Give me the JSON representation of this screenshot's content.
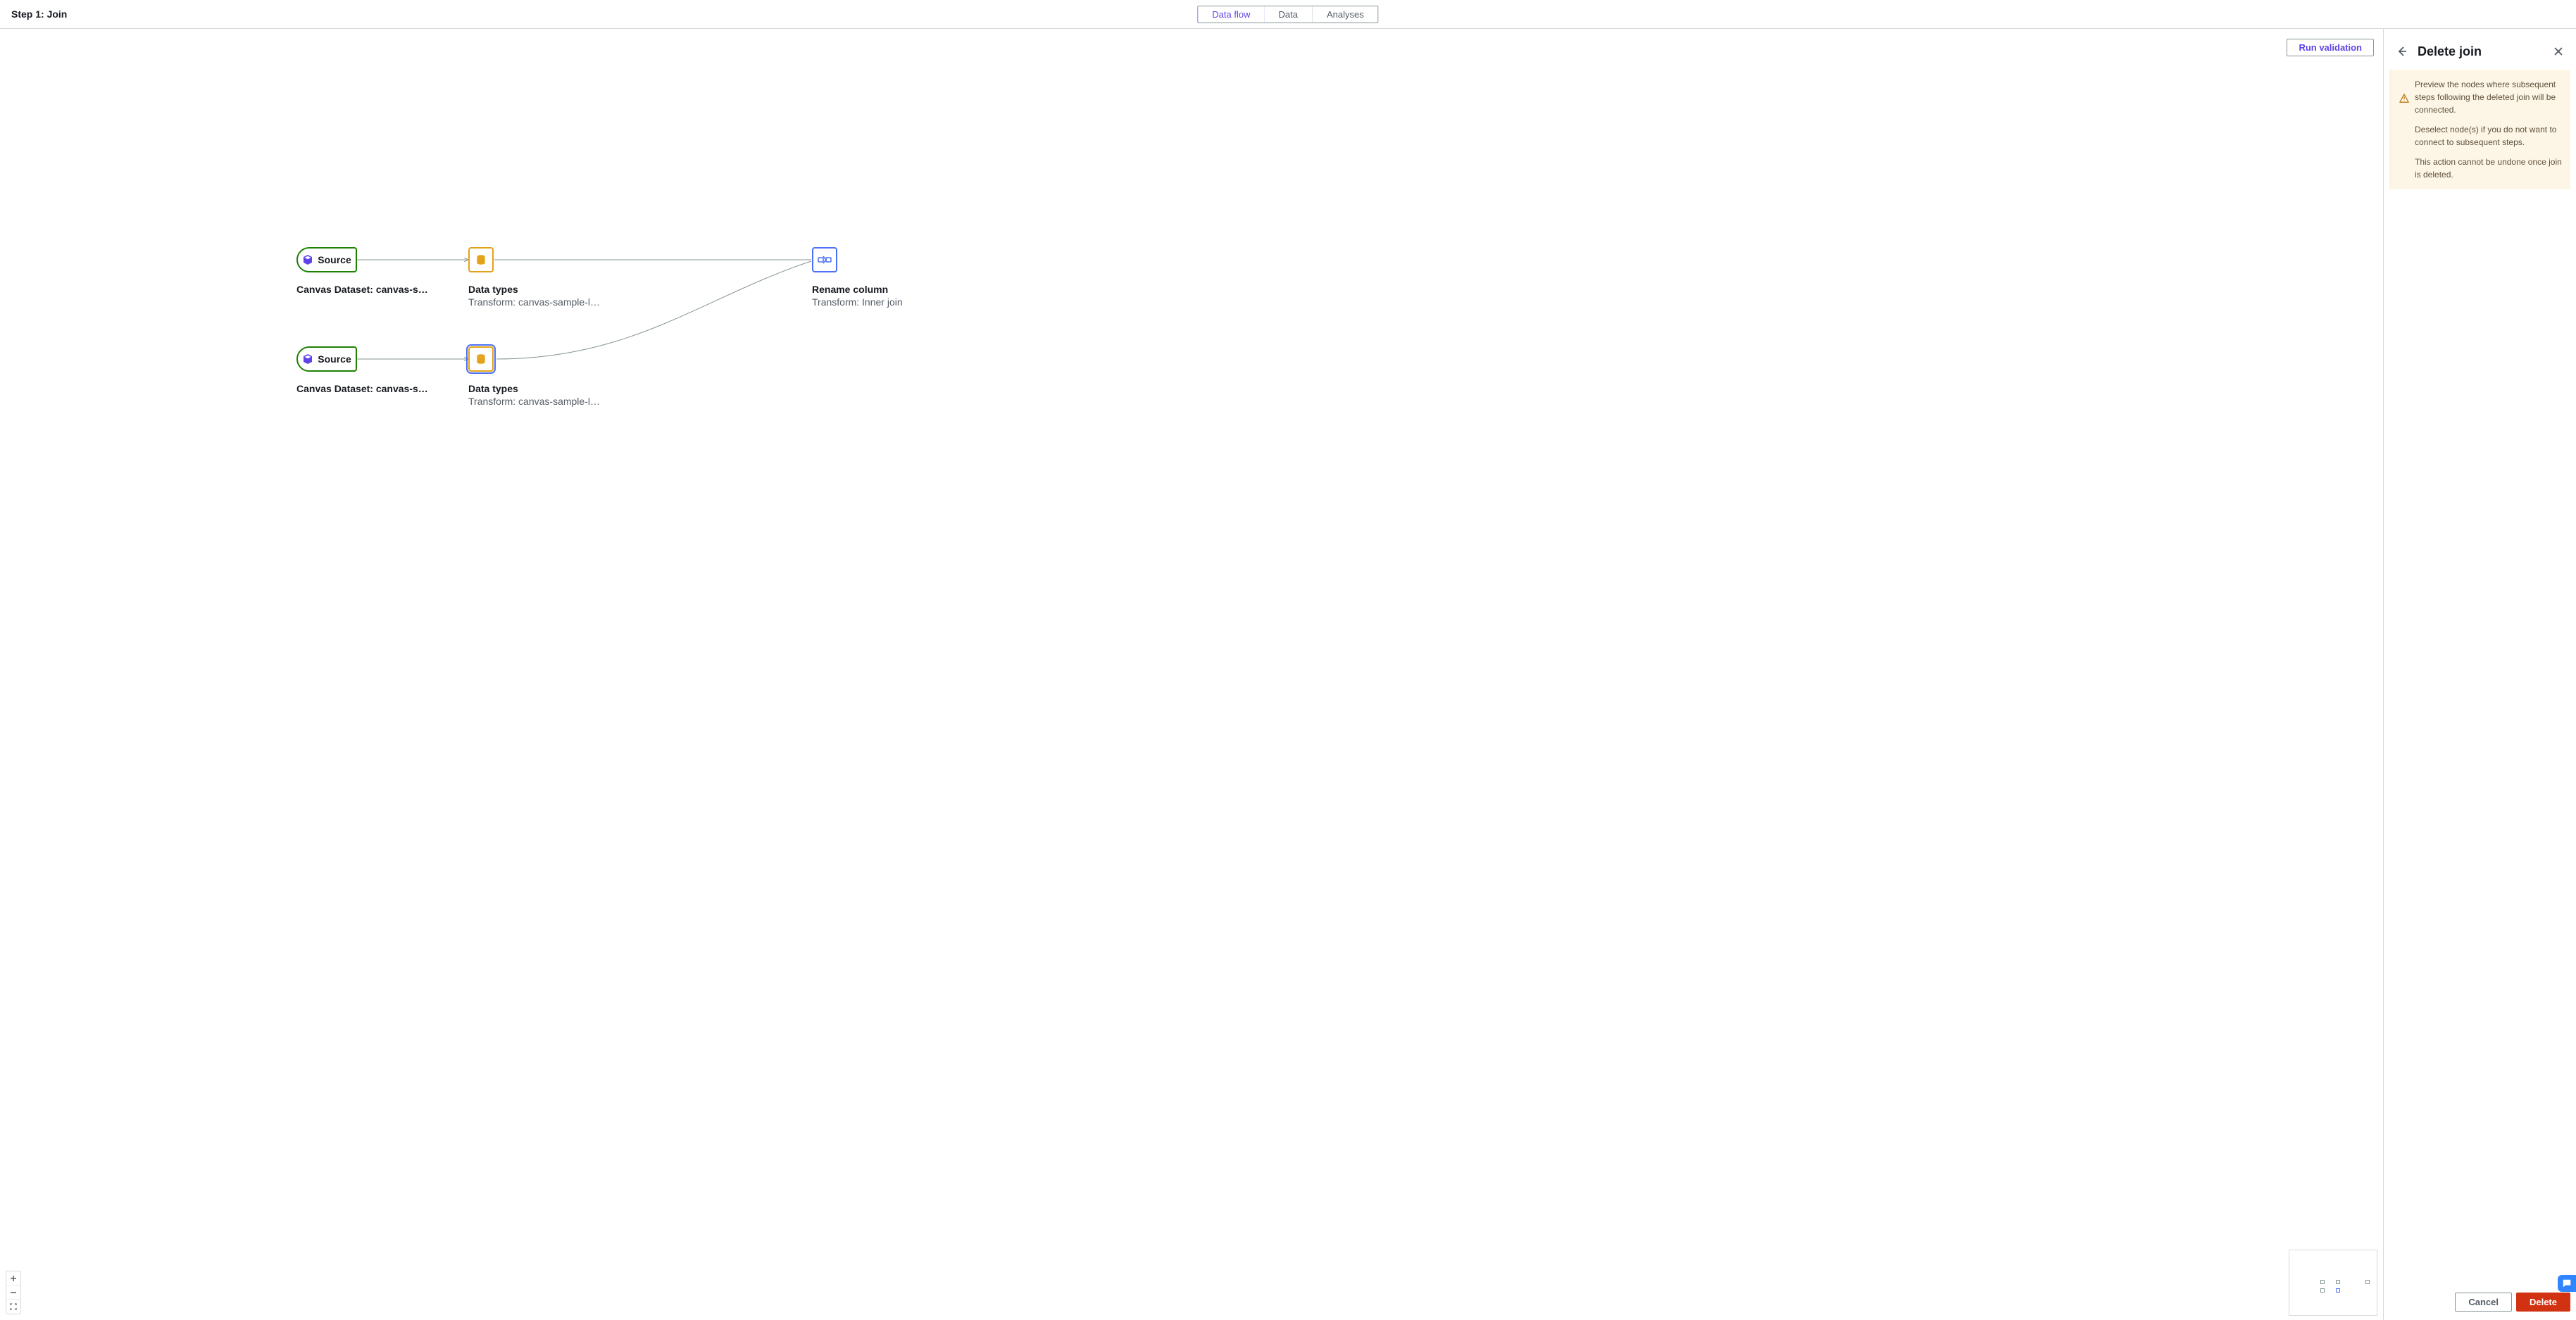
{
  "header": {
    "title": "Step 1: Join",
    "tabs": {
      "data_flow": "Data flow",
      "data": "Data",
      "analyses": "Analyses"
    }
  },
  "actions": {
    "run_validation": "Run validation"
  },
  "nodes": {
    "source1": {
      "label": "Source",
      "title": "Canvas Dataset: canvas-sample-…"
    },
    "data_types1": {
      "title": "Data types",
      "subtitle": "Transform: canvas-sample-loans-part-…"
    },
    "source2": {
      "label": "Source",
      "title": "Canvas Dataset: canvas-sample-…"
    },
    "data_types2": {
      "title": "Data types",
      "subtitle": "Transform: canvas-sample-loans-part-…"
    },
    "rename": {
      "title": "Rename column",
      "subtitle": "Transform: Inner join"
    }
  },
  "panel": {
    "title": "Delete join",
    "warning": {
      "line1": "Preview the nodes where subsequent steps following the deleted join will be connected.",
      "line2": "Deselect node(s) if you do not want to connect to subsequent steps.",
      "line3": "This action cannot be undone once join is deleted."
    },
    "cancel": "Cancel",
    "delete": "Delete"
  }
}
